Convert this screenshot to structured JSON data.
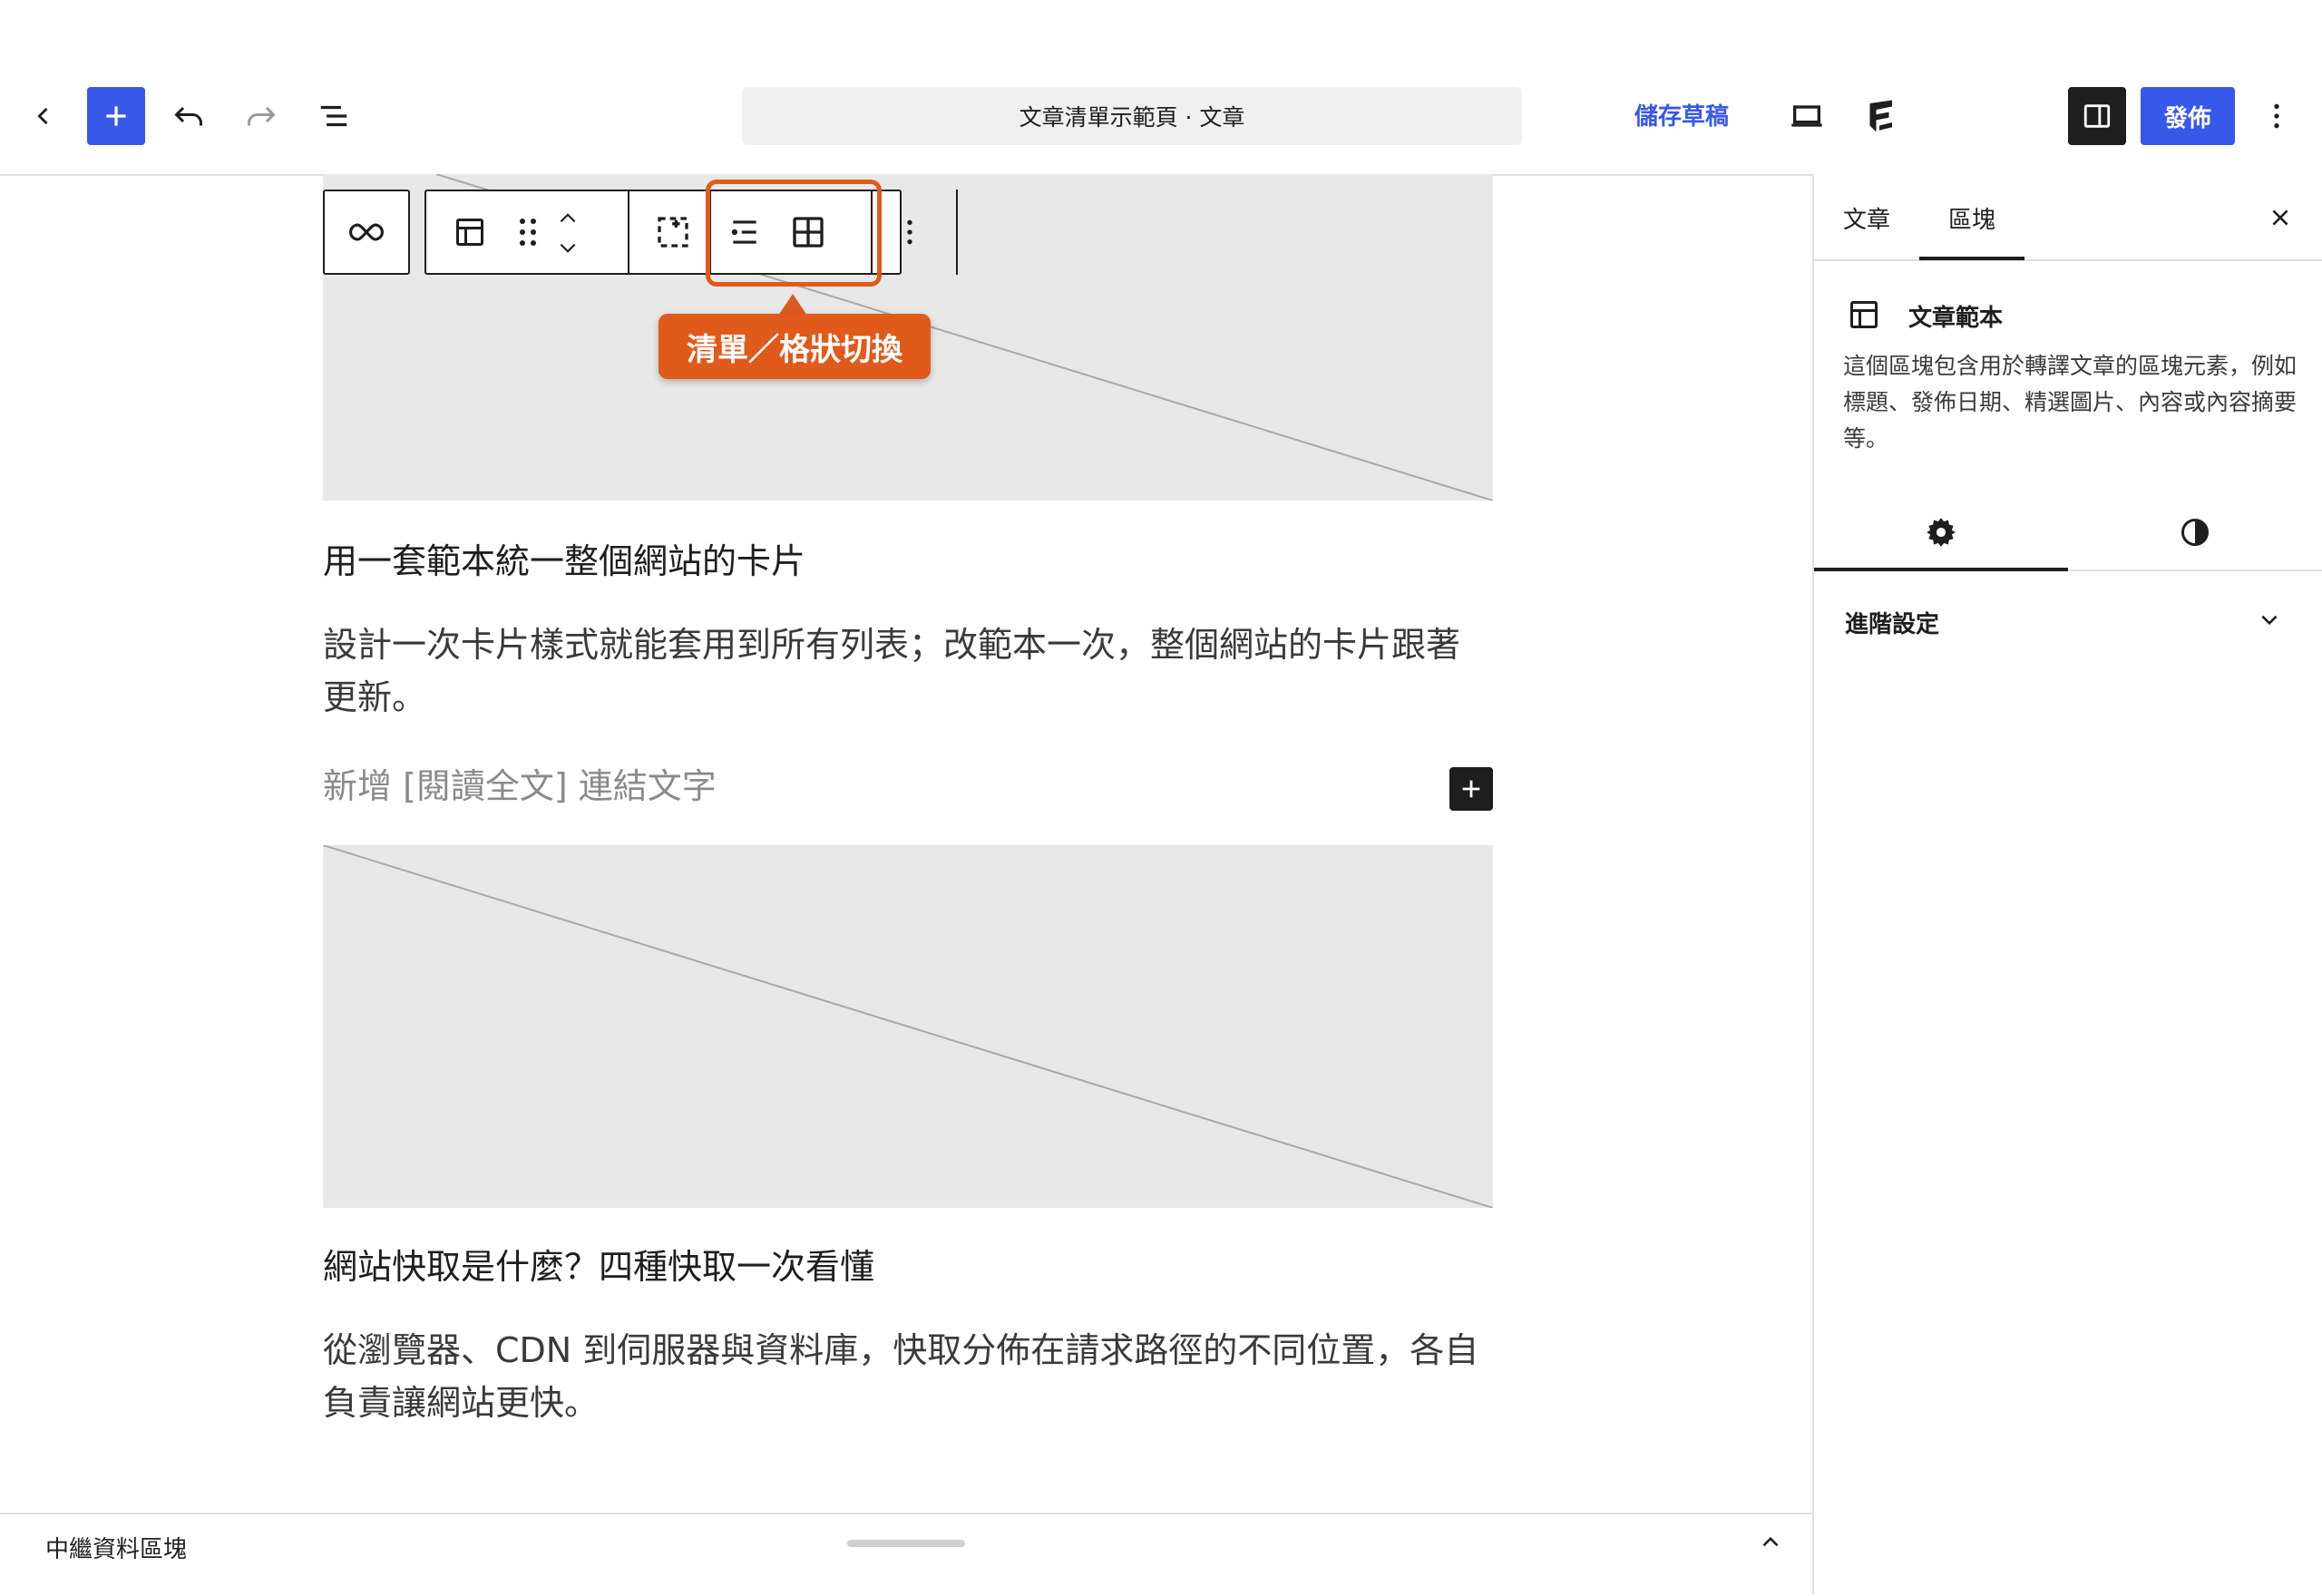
{
  "header": {
    "document_title": "文章清單示範頁 · 文章",
    "save_draft_label": "儲存草稿",
    "publish_label": "發佈",
    "icons": [
      "back-icon",
      "add-block-icon",
      "undo-icon",
      "redo-icon",
      "list-view-icon",
      "preview-icon",
      "site-logo-icon",
      "settings-panel-icon",
      "more-options-icon"
    ]
  },
  "block_toolbar": {
    "callout_label": "清單／格狀切換",
    "highlight_color": "#e05a1b"
  },
  "posts": [
    {
      "title": "用一套範本統一整個網站的卡片",
      "excerpt": "設計一次卡片樣式就能套用到所有列表；改範本一次，整個網站的卡片跟著更新。"
    },
    {
      "title": "網站快取是什麼？四種快取一次看懂",
      "excerpt": "從瀏覽器、CDN 到伺服器與資料庫，快取分佈在請求路徑的不同位置，各自負責讓網站更快。"
    }
  ],
  "read_more_placeholder": "新增 [閱讀全文] 連結文字",
  "sidebar": {
    "tabs": [
      {
        "label": "文章"
      },
      {
        "label": "區塊"
      }
    ],
    "active_tab": "區塊",
    "block_name": "文章範本",
    "block_description": "這個區塊包含用於轉譯文章的區塊元素，例如標題、發佈日期、精選圖片、內容或內容摘要等。",
    "advanced_label": "進階設定"
  },
  "footer": {
    "label": "中繼資料區塊"
  },
  "colors": {
    "accent": "#3858e9",
    "highlight": "#e05a1b",
    "placeholder_bg": "#e8e8e8"
  }
}
